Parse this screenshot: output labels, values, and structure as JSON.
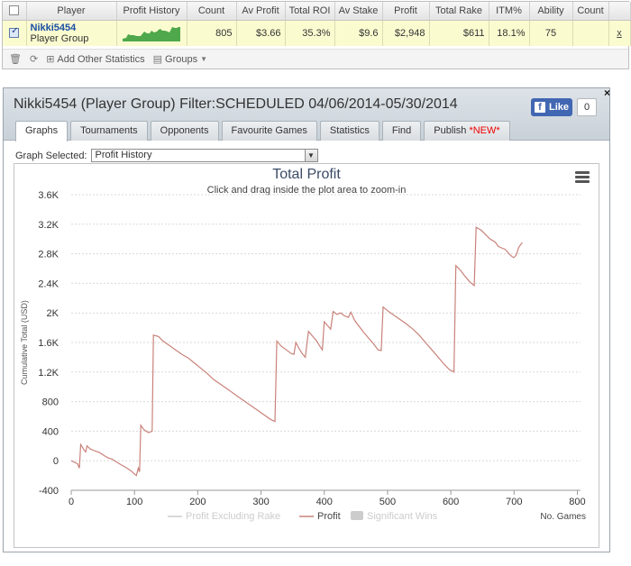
{
  "stats": {
    "columns": [
      "Player",
      "Profit History",
      "Count",
      "Av Profit",
      "Total ROI",
      "Av Stake",
      "Profit",
      "Total Rake",
      "ITM%",
      "Ability",
      "Count"
    ],
    "row": {
      "player_name": "Nikki5454",
      "player_group": "Player Group",
      "count": "805",
      "av_profit": "$3.66",
      "total_roi": "35.3%",
      "av_stake": "$9.6",
      "profit": "$2,948",
      "total_rake": "$611",
      "itm": "18.1%",
      "ability": "75",
      "count2": "",
      "remove": "x"
    },
    "toolbar": {
      "add_stats_label": "Add Other Statistics",
      "groups_label": "Groups"
    }
  },
  "panel": {
    "title": "Nikki5454 (Player Group) Filter:SCHEDULED 04/06/2014-05/30/2014",
    "close": "×",
    "fb_like_label": "Like",
    "fb_count": "0",
    "tabs": [
      {
        "label": "Graphs",
        "active": true
      },
      {
        "label": "Tournaments"
      },
      {
        "label": "Opponents"
      },
      {
        "label": "Favourite Games"
      },
      {
        "label": "Statistics"
      },
      {
        "label": "Find"
      },
      {
        "label": "Publish",
        "badge": "*NEW*"
      }
    ],
    "graph_selected_label": "Graph Selected:",
    "graph_selected_value": "Profit History"
  },
  "colors": {
    "profit_line": "#c9827a",
    "legend_inactive": "#cccccc",
    "accent_blue": "#1a4fa3",
    "highlight_row": "#fbfbd0"
  },
  "chart_data": {
    "type": "line",
    "title": "Total Profit",
    "subtitle": "Click and drag inside the plot area to zoom-in",
    "xlabel": "No. Games",
    "ylabel": "Cumulative Total (USD)",
    "xlim": [
      0,
      805
    ],
    "ylim": [
      -400,
      3600
    ],
    "xticks": [
      0,
      100,
      200,
      300,
      400,
      500,
      600,
      700,
      800
    ],
    "yticks": [
      -400,
      0,
      400,
      800,
      1200,
      1600,
      2000,
      2400,
      2800,
      3200,
      3600
    ],
    "ytick_labels": [
      "-400",
      "0",
      "400",
      "800",
      "1.2K",
      "1.6K",
      "2K",
      "2.4K",
      "2.8K",
      "3.2K",
      "3.6K"
    ],
    "grid": true,
    "legend_position": "bottom",
    "series": [
      {
        "name": "Profit",
        "visible": true,
        "points": [
          [
            0,
            0
          ],
          [
            5,
            -20
          ],
          [
            10,
            -40
          ],
          [
            13,
            -100
          ],
          [
            15,
            220
          ],
          [
            18,
            180
          ],
          [
            20,
            150
          ],
          [
            23,
            120
          ],
          [
            25,
            200
          ],
          [
            30,
            160
          ],
          [
            38,
            130
          ],
          [
            45,
            110
          ],
          [
            50,
            80
          ],
          [
            58,
            40
          ],
          [
            65,
            20
          ],
          [
            72,
            -20
          ],
          [
            80,
            -60
          ],
          [
            88,
            -100
          ],
          [
            95,
            -140
          ],
          [
            100,
            -180
          ],
          [
            103,
            -200
          ],
          [
            106,
            -100
          ],
          [
            108,
            -150
          ],
          [
            110,
            480
          ],
          [
            115,
            420
          ],
          [
            122,
            380
          ],
          [
            128,
            400
          ],
          [
            130,
            1700
          ],
          [
            138,
            1680
          ],
          [
            145,
            1620
          ],
          [
            155,
            1560
          ],
          [
            165,
            1500
          ],
          [
            175,
            1440
          ],
          [
            185,
            1390
          ],
          [
            195,
            1320
          ],
          [
            205,
            1250
          ],
          [
            215,
            1180
          ],
          [
            225,
            1100
          ],
          [
            235,
            1040
          ],
          [
            245,
            980
          ],
          [
            255,
            920
          ],
          [
            265,
            860
          ],
          [
            275,
            800
          ],
          [
            285,
            740
          ],
          [
            295,
            680
          ],
          [
            305,
            620
          ],
          [
            315,
            560
          ],
          [
            322,
            530
          ],
          [
            325,
            1620
          ],
          [
            332,
            1550
          ],
          [
            340,
            1500
          ],
          [
            348,
            1450
          ],
          [
            352,
            1440
          ],
          [
            355,
            1600
          ],
          [
            360,
            1520
          ],
          [
            365,
            1450
          ],
          [
            370,
            1400
          ],
          [
            375,
            1750
          ],
          [
            382,
            1680
          ],
          [
            388,
            1620
          ],
          [
            393,
            1550
          ],
          [
            397,
            1500
          ],
          [
            400,
            1880
          ],
          [
            406,
            1820
          ],
          [
            410,
            1780
          ],
          [
            414,
            2020
          ],
          [
            420,
            1980
          ],
          [
            426,
            2000
          ],
          [
            432,
            1960
          ],
          [
            438,
            1940
          ],
          [
            442,
            2010
          ],
          [
            448,
            1900
          ],
          [
            455,
            1820
          ],
          [
            462,
            1740
          ],
          [
            470,
            1660
          ],
          [
            478,
            1580
          ],
          [
            485,
            1500
          ],
          [
            490,
            1490
          ],
          [
            493,
            2080
          ],
          [
            500,
            2030
          ],
          [
            510,
            1970
          ],
          [
            520,
            1910
          ],
          [
            530,
            1850
          ],
          [
            540,
            1780
          ],
          [
            550,
            1700
          ],
          [
            560,
            1600
          ],
          [
            570,
            1500
          ],
          [
            580,
            1400
          ],
          [
            590,
            1300
          ],
          [
            598,
            1230
          ],
          [
            605,
            1200
          ],
          [
            608,
            2640
          ],
          [
            615,
            2580
          ],
          [
            622,
            2500
          ],
          [
            630,
            2420
          ],
          [
            637,
            2370
          ],
          [
            640,
            3160
          ],
          [
            648,
            3120
          ],
          [
            655,
            3060
          ],
          [
            662,
            3000
          ],
          [
            670,
            2960
          ],
          [
            675,
            2900
          ],
          [
            680,
            2880
          ],
          [
            686,
            2860
          ],
          [
            692,
            2800
          ],
          [
            697,
            2760
          ],
          [
            700,
            2750
          ],
          [
            703,
            2780
          ],
          [
            705,
            2820
          ],
          [
            707,
            2880
          ],
          [
            710,
            2920
          ],
          [
            713,
            2950
          ]
        ]
      },
      {
        "name": "Profit Excluding Rake",
        "visible": false,
        "points": []
      },
      {
        "name": "Significant Wins",
        "visible": false,
        "points": []
      }
    ]
  }
}
